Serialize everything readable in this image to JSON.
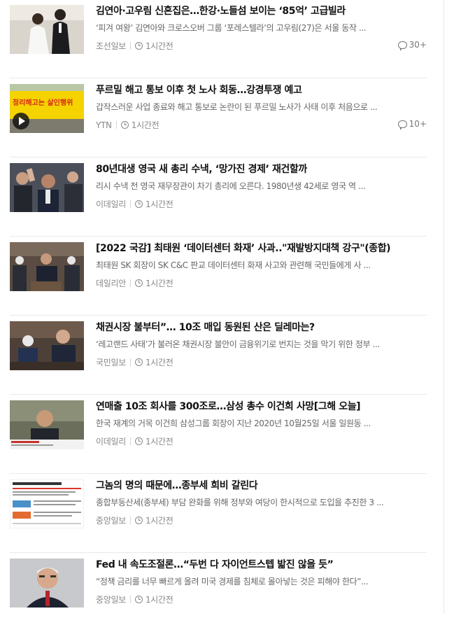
{
  "articles": [
    {
      "title": "김연아·고우림 신혼집은…한강·노들섬 보이는 ‘85억’ 고급빌라",
      "summary": "‘피겨 여왕’ 김연아와 크로스오버 그룹 ‘포레스텔라’의 고우림(27)은 서울 동작 ...",
      "press": "조선일보",
      "time": "1시간전",
      "comments": "30+",
      "thumb_icon": "wedding-photo"
    },
    {
      "title": "푸르밀 해고 통보 이후 첫 노사 회동…강경투쟁 예고",
      "summary": "갑작스러운 사업 종료와 해고 통보로 논란이 된 푸르밀 노사가 사태 이후 처음으로 ...",
      "press": "YTN",
      "time": "1시간전",
      "comments": "10+",
      "thumb_icon": "protest-banner-video",
      "thumb_text": "정리해고는 살인행위"
    },
    {
      "title": "80년대생 영국 새 총리 수낵, ‘망가진 경제’ 재건할까",
      "summary": "리시 수낵 전 영국 재무장관이 차기 총리에 오른다. 1980년생 42세로 영국 역 ...",
      "press": "이데일리",
      "time": "1시간전",
      "thumb_icon": "crowd-photo"
    },
    {
      "title": "[2022 국감] 최태원 ‘데이터센터 화재’ 사과..\"재발방지대책 강구\"(종합)",
      "summary": "최태원 SK 회장이 SK C&C 판교 데이터센터 화재 사고와 관련해 국민들에게 사 ...",
      "press": "데일리안",
      "time": "1시간전",
      "thumb_icon": "hearing-photo"
    },
    {
      "title": "채권시장 불부터”… 10조 매입 동원된 산은 딜레마는?",
      "summary": "‘레고랜드 사태’가 불러온 채권시장 불안이 금융위기로 번지는 것을 막기 위한 정부 ...",
      "press": "국민일보",
      "time": "1시간전",
      "thumb_icon": "meeting-photo"
    },
    {
      "title": "연매출 10조 회사를 300조로…삼성 총수 이건희 사망[그해 오늘]",
      "summary": "한국 재계의 거목 이건희 삼성그룹 회장이 지난 2020년 10월25일 서울 일원동 ...",
      "press": "이데일리",
      "time": "1시간전",
      "thumb_icon": "portrait-photo"
    },
    {
      "title": "그놈의 명의 때문에…종부세 희비 갈린다",
      "summary": "종합부동산세(종부세) 부담 완화를 위해 정부와 여당이 한시적으로 도입을 추진한 3 ...",
      "press": "중앙일보",
      "time": "1시간전",
      "thumb_icon": "infographic"
    },
    {
      "title": "Fed 내 속도조절론…“두번 다 자이언트스텝 밟진 않을 듯”",
      "summary": "“정책 금리를 너무 빠르게 올려 미국 경제를 침체로 몰아넣는 것은 피해야 한다”...",
      "press": "중앙일보",
      "time": "1시간전",
      "thumb_icon": "portrait-photo"
    }
  ],
  "colors": {
    "title": "#111111",
    "summary": "#666666",
    "meta": "#888888",
    "divider": "#e9e9e9",
    "banner_yellow": "#f4d300",
    "banner_red": "#d8281e"
  }
}
